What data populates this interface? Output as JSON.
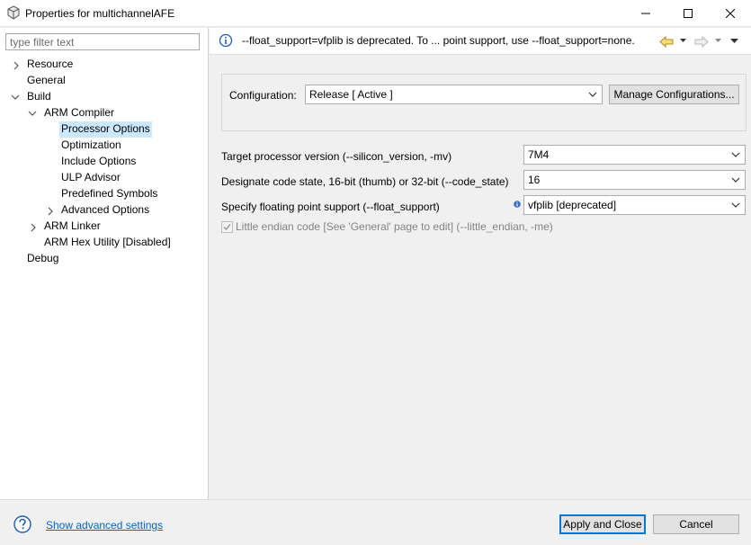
{
  "window": {
    "title": "Properties for multichannelAFE"
  },
  "sidebar": {
    "filter_placeholder": "type filter text",
    "items": [
      {
        "label": "Resource"
      },
      {
        "label": "General"
      },
      {
        "label": "Build"
      },
      {
        "label": "ARM Compiler"
      },
      {
        "label": "Processor Options"
      },
      {
        "label": "Optimization"
      },
      {
        "label": "Include Options"
      },
      {
        "label": "ULP Advisor"
      },
      {
        "label": "Predefined Symbols"
      },
      {
        "label": "Advanced Options"
      },
      {
        "label": "ARM Linker"
      },
      {
        "label": "ARM Hex Utility  [Disabled]"
      },
      {
        "label": "Debug"
      }
    ]
  },
  "message": {
    "text": "--float_support=vfplib is deprecated. To ... point support, use --float_support=none."
  },
  "config": {
    "label": "Configuration:",
    "value": "Release  [ Active ]",
    "manage_button": "Manage Configurations..."
  },
  "options": [
    {
      "label": "Target processor version (--silicon_version, -mv)",
      "value": "7M4"
    },
    {
      "label": "Designate code state, 16-bit (thumb) or 32-bit (--code_state)",
      "value": "16"
    },
    {
      "label": "Specify floating point support (--float_support)",
      "value": "vfplib [deprecated]"
    }
  ],
  "little_endian": {
    "label": "Little endian code [See 'General' page to edit] (--little_endian, -me)",
    "checked": true
  },
  "footer": {
    "advanced_link": "Show advanced settings",
    "apply_close": "Apply and Close",
    "cancel": "Cancel"
  },
  "colors": {
    "selection": "#cce8ff",
    "link": "#0066cc",
    "info": "#1a5fb4",
    "default_button_border": "#0078d7"
  }
}
